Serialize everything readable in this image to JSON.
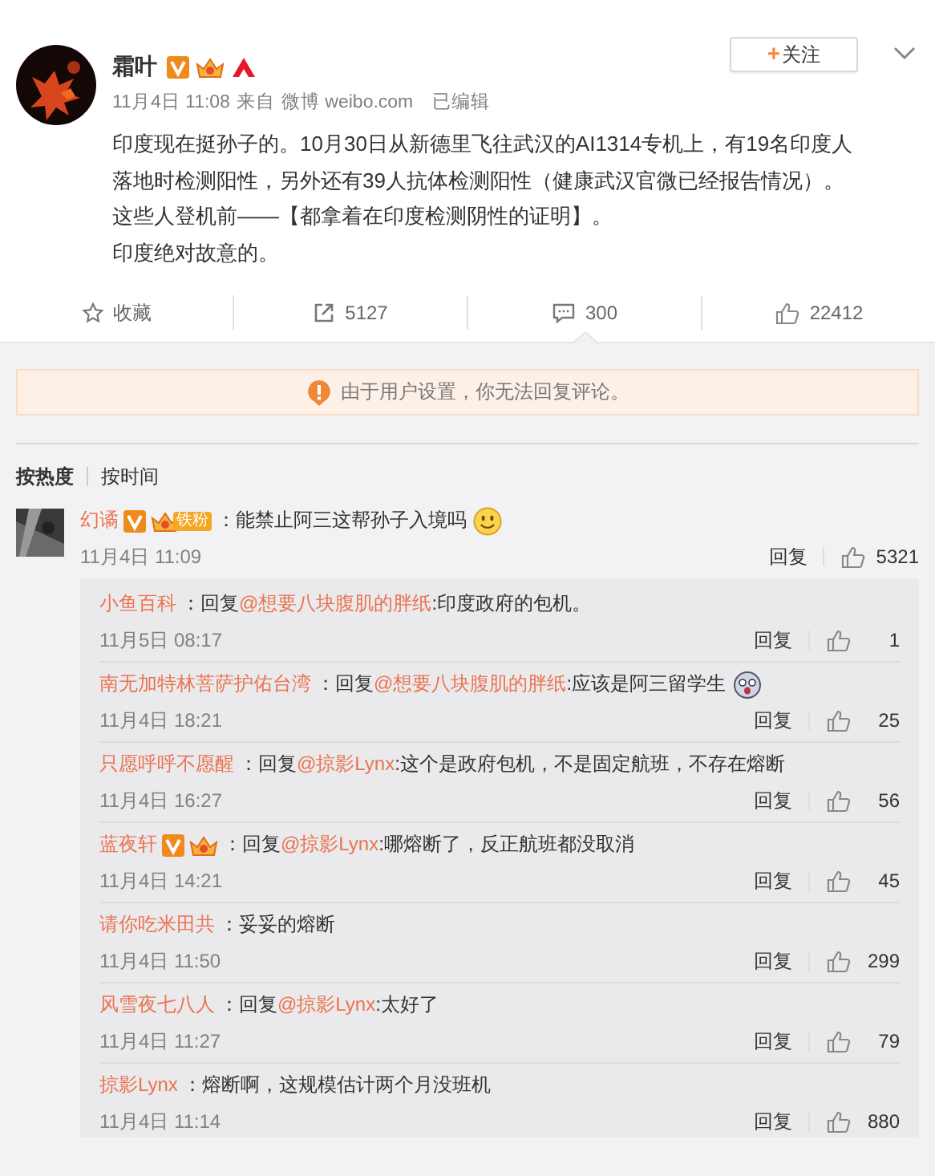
{
  "post": {
    "author": "霜叶",
    "verified": true,
    "crown": true,
    "red_logo": true,
    "time": "11月4日 11:08",
    "source_prefix": "来自",
    "source": "微博 weibo.com",
    "edited": "已编辑",
    "follow": {
      "icon": "+",
      "label": "关注"
    },
    "paragraphs": [
      "印度现在挺孙子的。10月30日从新德里飞往武汉的AI1314专机上，有19名印度人落地时检测阳性，另外还有39人抗体检测阳性（健康武汉官微已经报告情况）。",
      "这些人登机前——【都拿着在印度检测阴性的证明】。",
      "印度绝对故意的。"
    ]
  },
  "actions": [
    {
      "kind": "star",
      "label": "收藏",
      "selected": false
    },
    {
      "kind": "share",
      "label": "5127",
      "selected": false
    },
    {
      "kind": "comment",
      "label": "300",
      "selected": true
    },
    {
      "kind": "like",
      "label": "22412",
      "selected": false
    }
  ],
  "notice": "由于用户设置，你无法回复评论。",
  "sort_tabs": [
    {
      "label": "按热度",
      "selected": true
    },
    {
      "label": "按时间",
      "selected": false
    }
  ],
  "comments": [
    {
      "author": "幻谲",
      "verified": true,
      "fan": true,
      "fan_label": "铁粉",
      "sep": "：",
      "text": "能禁止阿三这帮孙子入境吗",
      "emoji": true,
      "time": "11月4日 11:09",
      "reply": "回复",
      "likes": "5321",
      "replies": [
        {
          "author": "小鱼百科",
          "prefix": "：回复",
          "mention": "@想要八块腹肌的胖纸",
          "text": ":印度政府的包机。",
          "emoji": false,
          "time": "11月5日 08:17",
          "reply": "回复",
          "likes": "1"
        },
        {
          "author": "南无加特林菩萨护佑台湾",
          "prefix": "：回复",
          "mention": "@想要八块腹肌的胖纸",
          "text": ":应该是阿三留学生",
          "emoji": true,
          "time": "11月4日 18:21",
          "reply": "回复",
          "likes": "25"
        },
        {
          "author": "只愿呼呼不愿醒",
          "prefix": "：回复",
          "mention": "@掠影Lynx",
          "text": ":这个是政府包机，不是固定航班，不存在熔断",
          "emoji": false,
          "time": "11月4日 16:27",
          "reply": "回复",
          "likes": "56"
        },
        {
          "author": "蓝夜轩",
          "verified": true,
          "crown": true,
          "prefix": "：回复",
          "mention": "@掠影Lynx",
          "text": ":哪熔断了，反正航班都没取消",
          "emoji": false,
          "time": "11月4日 14:21",
          "reply": "回复",
          "likes": "45"
        },
        {
          "author": "请你吃米田共",
          "prefix": "：",
          "text": "妥妥的熔断",
          "emoji": false,
          "time": "11月4日 11:50",
          "reply": "回复",
          "likes": "299"
        },
        {
          "author": "风雪夜七八人",
          "prefix": "：回复",
          "mention": "@掠影Lynx",
          "text": ":太好了",
          "emoji": false,
          "time": "11月4日 11:27",
          "reply": "回复",
          "likes": "79"
        },
        {
          "author": "掠影Lynx",
          "prefix": "：",
          "text": "熔断啊，这规模估计两个月没班机",
          "emoji": false,
          "time": "11月4日 11:14",
          "reply": "回复",
          "likes": "880"
        }
      ]
    }
  ]
}
